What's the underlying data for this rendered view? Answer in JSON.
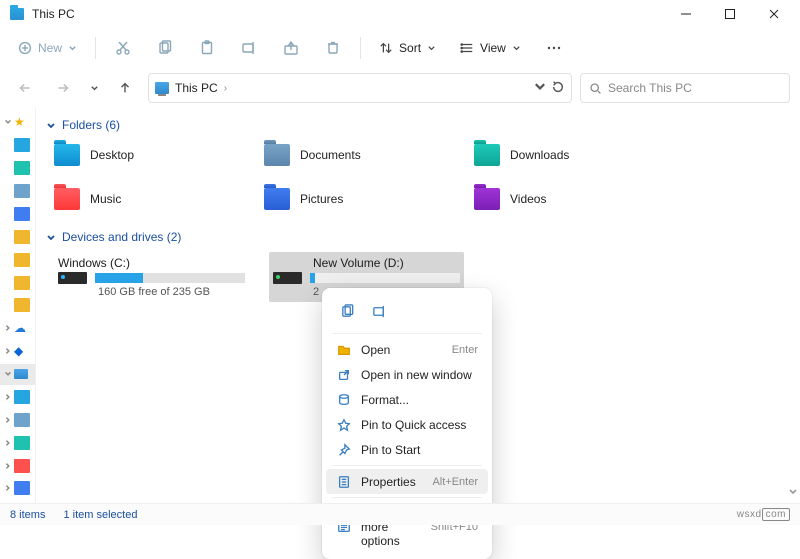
{
  "window": {
    "title": "This PC"
  },
  "toolbar": {
    "new_label": "New",
    "sort_label": "Sort",
    "view_label": "View"
  },
  "address": {
    "crumb": "This PC"
  },
  "search": {
    "placeholder": "Search This PC"
  },
  "sections": {
    "folders_header": "Folders (6)",
    "drives_header": "Devices and drives (2)"
  },
  "folders": {
    "desktop": "Desktop",
    "documents": "Documents",
    "downloads": "Downloads",
    "music": "Music",
    "pictures": "Pictures",
    "videos": "Videos"
  },
  "drives": {
    "c": {
      "name": "Windows (C:)",
      "sub": "160 GB free of 235 GB",
      "fill_pct": 32
    },
    "d": {
      "name": "New Volume (D:)",
      "sub": "2",
      "fill_pct": 3
    }
  },
  "context_menu": {
    "open": "Open",
    "open_accel": "Enter",
    "open_new": "Open in new window",
    "format": "Format...",
    "pin_quick": "Pin to Quick access",
    "pin_start": "Pin to Start",
    "properties": "Properties",
    "properties_accel": "Alt+Enter",
    "more": "Show more options",
    "more_accel": "Shift+F10"
  },
  "status": {
    "items": "8 items",
    "selected": "1 item selected",
    "watermark_a": "wsxd",
    "watermark_b": "com"
  }
}
